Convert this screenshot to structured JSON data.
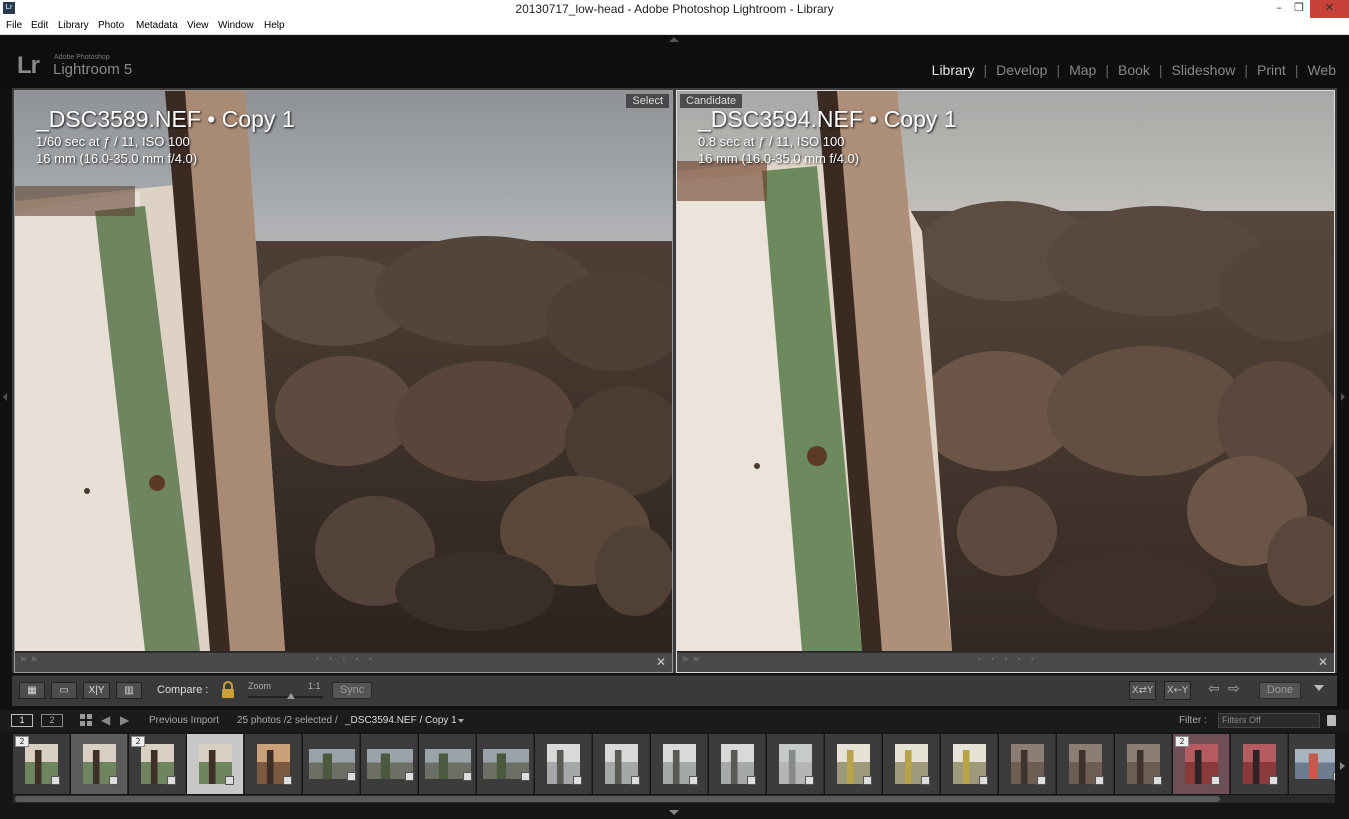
{
  "window": {
    "title": "20130717_low-head - Adobe Photoshop Lightroom - Library",
    "app_icon_text": "Lr",
    "minimize_glyph": "–",
    "maximize_glyph": "❐",
    "close_glyph": "✕"
  },
  "menu": [
    "File",
    "Edit",
    "Library",
    "Photo",
    "Metadata",
    "View",
    "Window",
    "Help"
  ],
  "identity": {
    "lr": "Lr",
    "sub": "Adobe Photoshop",
    "name": "Lightroom 5"
  },
  "modules": [
    "Library",
    "Develop",
    "Map",
    "Book",
    "Slideshow",
    "Print",
    "Web"
  ],
  "active_module": "Library",
  "module_separator": "|",
  "select_pane": {
    "badge": "Select",
    "filename": "_DSC3589.NEF • Copy 1",
    "exposure": "1/60 sec at ƒ / 11, ISO 100",
    "lens": "16 mm (16.0-35.0 mm f/4.0)"
  },
  "candidate_pane": {
    "badge": "Candidate",
    "filename": "_DSC3594.NEF • Copy 1",
    "exposure": "0.8 sec at ƒ / 11, ISO 100",
    "lens": "16 mm (16.0-35.0 mm f/4.0)"
  },
  "pane_close": "✕",
  "pane_dots": "• • • • •",
  "pane_flags": "⚑ ⚑",
  "toolbar": {
    "grid_glyph": "▦",
    "loupe_glyph": "▭",
    "compare_glyph": "X|Y",
    "survey_glyph": "▥",
    "compare_label": "Compare :",
    "zoom_label": "Zoom",
    "zoom_max": "1:1",
    "sync_label": "Sync",
    "swap_glyph": "X⇄Y",
    "promote_glyph": "X←Y",
    "prev_glyph": "⇦",
    "next_glyph": "⇨",
    "done_label": "Done"
  },
  "filmbar": {
    "screen1": "1",
    "screen2": "2",
    "back_glyph": "◀",
    "fwd_glyph": "▶",
    "source": "Previous Import",
    "count": "25 photos /2 selected /",
    "current": "_DSC3594.NEF / Copy 1",
    "filter_label": "Filter :",
    "filter_value": "Filters Off"
  },
  "frames": [
    {
      "kind": "post",
      "state": "normal",
      "stack": "2"
    },
    {
      "kind": "post",
      "state": "selected",
      "stack": ""
    },
    {
      "kind": "post",
      "state": "normal",
      "stack": "2"
    },
    {
      "kind": "post",
      "state": "active",
      "stack": ""
    },
    {
      "kind": "post-warm",
      "state": "normal",
      "stack": ""
    },
    {
      "kind": "rock",
      "state": "normal",
      "stack": ""
    },
    {
      "kind": "rock",
      "state": "normal",
      "stack": ""
    },
    {
      "kind": "rock",
      "state": "normal",
      "stack": ""
    },
    {
      "kind": "rock",
      "state": "normal",
      "stack": ""
    },
    {
      "kind": "sea",
      "state": "normal",
      "stack": ""
    },
    {
      "kind": "sea",
      "state": "normal",
      "stack": ""
    },
    {
      "kind": "sea",
      "state": "normal",
      "stack": ""
    },
    {
      "kind": "sea",
      "state": "normal",
      "stack": ""
    },
    {
      "kind": "sea-flat",
      "state": "normal",
      "stack": ""
    },
    {
      "kind": "lighthouse",
      "state": "normal",
      "stack": ""
    },
    {
      "kind": "lighthouse",
      "state": "normal",
      "stack": ""
    },
    {
      "kind": "lighthouse",
      "state": "normal",
      "stack": ""
    },
    {
      "kind": "shore",
      "state": "normal",
      "stack": ""
    },
    {
      "kind": "shore",
      "state": "normal",
      "stack": ""
    },
    {
      "kind": "shore",
      "state": "normal",
      "stack": ""
    },
    {
      "kind": "sunset",
      "state": "pinkish",
      "stack": "2"
    },
    {
      "kind": "sunset",
      "state": "normal",
      "stack": ""
    },
    {
      "kind": "wide",
      "state": "normal",
      "stack": ""
    }
  ],
  "colors": {
    "background": "#111111",
    "panel": "#3b3b3b",
    "active_module": "#e6e6e6",
    "inactive_module": "#888888",
    "close_button": "#c7423a"
  }
}
